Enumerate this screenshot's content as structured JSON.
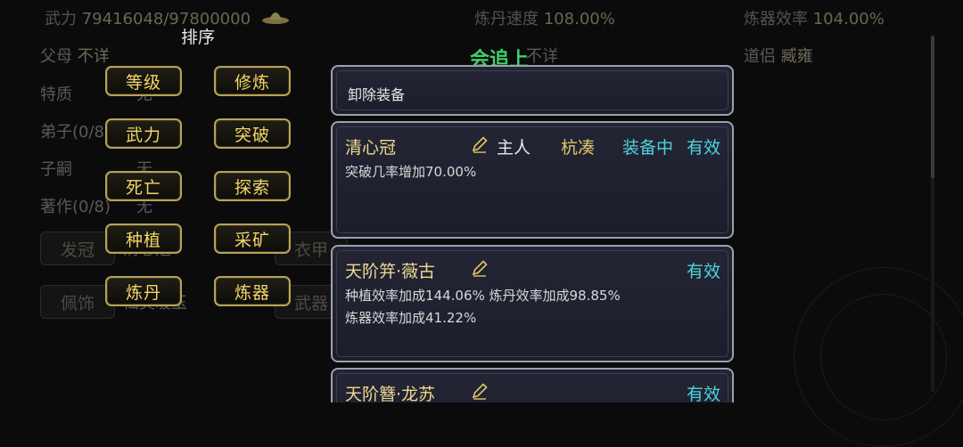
{
  "stats": {
    "wuli_label": "武力",
    "wuli_value": "79416048/97800000",
    "liandan_label": "炼丹速度",
    "liandan_value": "108.00%",
    "lianqi_label": "炼器效率",
    "lianqi_value": "104.00%"
  },
  "info": {
    "parents_label": "父母",
    "parents_value": "不详",
    "trait_label": "特质",
    "trait_value": "无",
    "disciples_label": "弟子(0/8)",
    "heirs_label": "子嗣",
    "heirs_value": "无",
    "works_label": "著作(0/8)",
    "works_value": "无",
    "mid_value": "不详",
    "partner_label": "道侣",
    "partner_value": "臧雍"
  },
  "equip_slots": {
    "crown_label": "发冠",
    "crown_value": "清心冠",
    "clothes_label": "衣甲",
    "accessory_label": "佩饰",
    "accessory_value": "仙灵暖玉",
    "weapon_label": "武器"
  },
  "sort": {
    "title": "排序",
    "buttons": [
      "等级",
      "修炼",
      "武力",
      "突破",
      "死亡",
      "探索",
      "种植",
      "采矿",
      "炼丹",
      "炼器"
    ]
  },
  "panel": {
    "title": "会追上",
    "unequip_label": "卸除装备",
    "items": [
      {
        "name": "清心冠",
        "owner": "主人",
        "holder": "杭凑",
        "status": "装备中",
        "validity": "有效",
        "effects": [
          "突破几率增加70.00%"
        ]
      },
      {
        "name": "天阶笄·薇古",
        "validity": "有效",
        "effects": [
          "种植效率加成144.06% 炼丹效率加成98.85%",
          "炼器效率加成41.22%"
        ]
      },
      {
        "name": "天阶簪·龙苏",
        "validity": "有效",
        "effects": []
      }
    ]
  }
}
